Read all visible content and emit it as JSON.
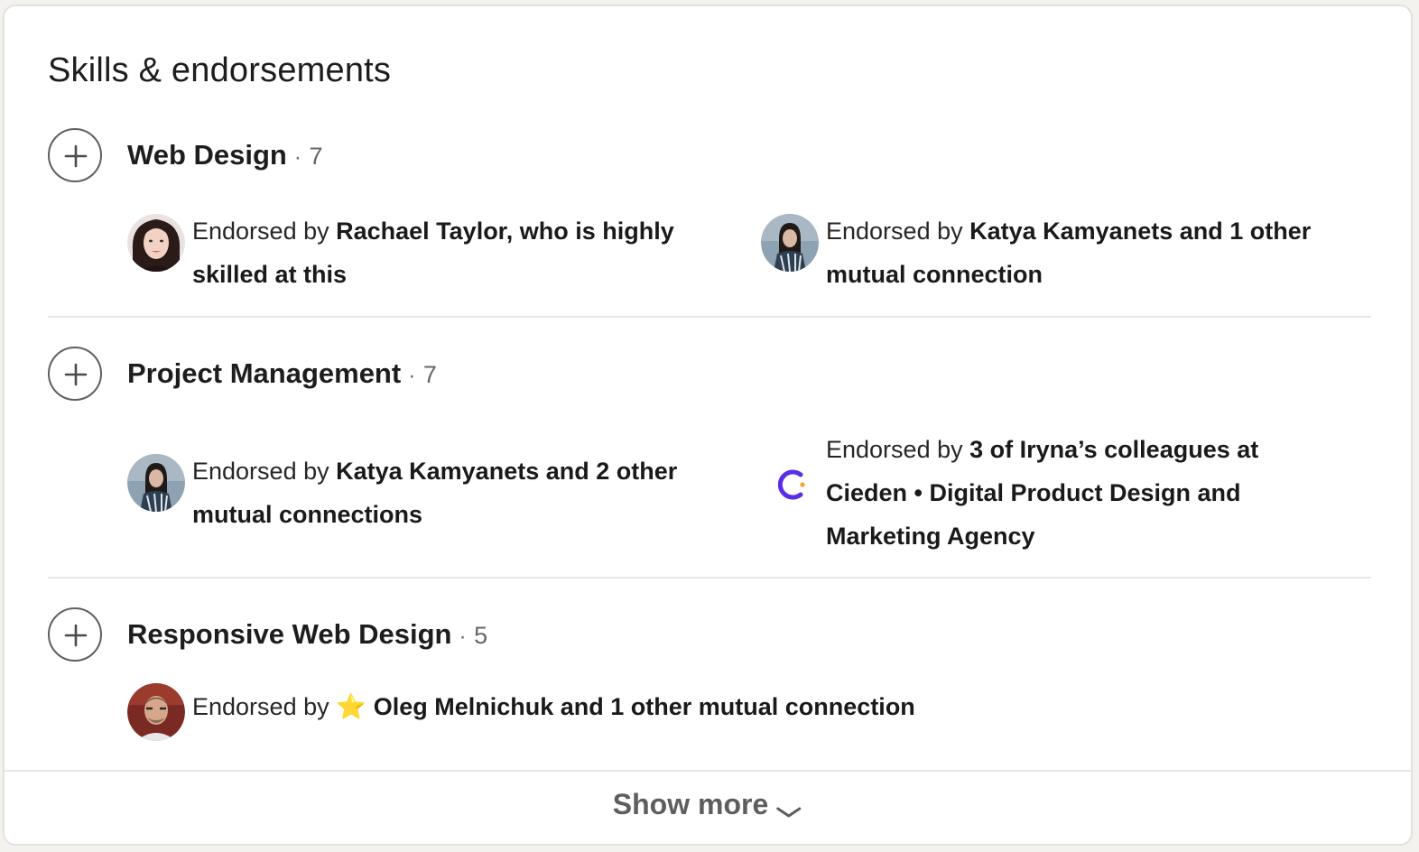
{
  "section": {
    "title": "Skills & endorsements"
  },
  "skills": [
    {
      "name": "Web Design",
      "separator": "·",
      "count": "7",
      "endorsements": [
        {
          "prefix": "Endorsed by ",
          "highlight": "Rachael Taylor, who is highly skilled at this",
          "avatar": "rachael-taylor-avatar"
        },
        {
          "prefix": "Endorsed by ",
          "highlight": "Katya Kamyanets and 1 other mutual connection",
          "avatar": "katya-kamyanets-avatar"
        }
      ]
    },
    {
      "name": "Project Management",
      "separator": "·",
      "count": "7",
      "endorsements": [
        {
          "prefix": "Endorsed by ",
          "highlight": "Katya Kamyanets and 2 other mutual connections",
          "avatar": "katya-kamyanets-avatar"
        },
        {
          "prefix": "Endorsed by ",
          "highlight": "3 of Iryna’s colleagues at Cieden • Digital Product Design and Marketing Agency",
          "avatar": "cieden-logo"
        }
      ]
    },
    {
      "name": "Responsive Web Design",
      "separator": "·",
      "count": "5",
      "endorsements": [
        {
          "prefix": "Endorsed by ",
          "star": "⭐",
          "highlight": "Oleg Melnichuk and 1 other mutual connection",
          "avatar": "oleg-melnichuk-avatar"
        }
      ]
    }
  ],
  "footer": {
    "show_more_label": "Show more"
  },
  "colors": {
    "background": "#f3f2ef",
    "card": "#ffffff",
    "cieden_purple": "#5a2ee6",
    "cieden_orange": "#f7a03a"
  }
}
